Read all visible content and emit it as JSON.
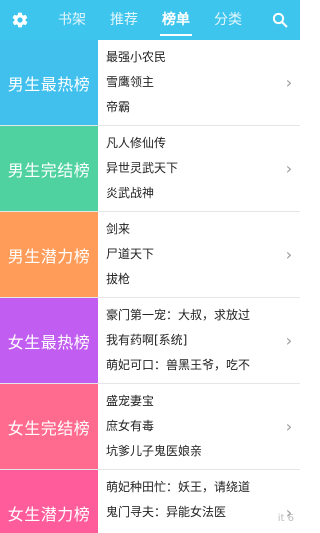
{
  "topbar": {
    "tabs": [
      {
        "label": "书架"
      },
      {
        "label": "推荐"
      },
      {
        "label": "榜单"
      },
      {
        "label": "分类"
      }
    ],
    "active_tab": "榜单",
    "accent_color": "#3ec5ee",
    "left_icon": "gear-icon",
    "right_icon": "search-icon"
  },
  "rankings": [
    {
      "label": "男生最热榜",
      "color": "#41c0ee",
      "books": [
        "最强小农民",
        "雪鹰领主",
        "帝霸"
      ]
    },
    {
      "label": "男生完结榜",
      "color": "#4fd2a0",
      "books": [
        "凡人修仙传",
        "异世灵武天下",
        "炎武战神"
      ]
    },
    {
      "label": "男生潜力榜",
      "color": "#ff9c5a",
      "books": [
        "剑来",
        "尸道天下",
        "拔枪"
      ]
    },
    {
      "label": "女生最热榜",
      "color": "#c15df0",
      "books": [
        "豪门第一宠：大叔，求放过",
        "我有药啊[系统]",
        "萌妃可口：兽黑王爷，吃不"
      ]
    },
    {
      "label": "女生完结榜",
      "color": "#ff6b8e",
      "books": [
        "盛宠妻宝",
        "庶女有毒",
        "坑爹儿子鬼医娘亲"
      ]
    },
    {
      "label": "女生潜力榜",
      "color": "#ff5c9c",
      "books": [
        "萌妃种田忙：妖王，请绕道",
        "鬼门寻夫：异能女法医",
        ""
      ]
    }
  ],
  "watermark": {
    "text": "it 6"
  }
}
